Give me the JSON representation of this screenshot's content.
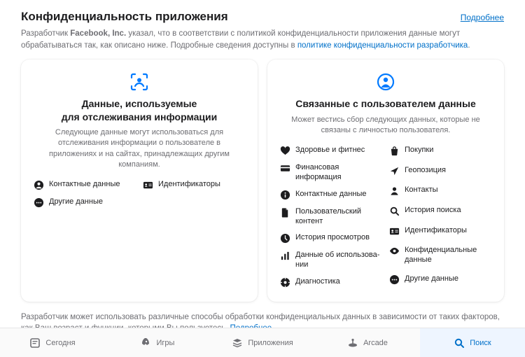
{
  "header": {
    "title": "Конфиденциальность приложения",
    "more": "Подробнее"
  },
  "intro": {
    "prefix": "Разработчик ",
    "developer": "Facebook, Inc.",
    "middle": " указал, что в соответствии с политикой конфиденциальности приложения данные могут обрабатываться так, как описано ниже. Подробные сведения доступны в ",
    "policy_link": "политике конфиденциальности разработчика",
    "suffix": "."
  },
  "cards": {
    "tracking": {
      "title_line1": "Данные, используемые",
      "title_line2": "для отслеживания информации",
      "desc": "Следующие данные могут использоваться для отслеживания информации о пользователе в приложениях и на сайтах, принадлежащих другим компаниям.",
      "items": [
        {
          "icon": "user-circle",
          "label": "Контактные данные"
        },
        {
          "icon": "id-card",
          "label": "Идентификаторы"
        },
        {
          "icon": "ellipsis",
          "label": "Другие данные"
        }
      ]
    },
    "linked": {
      "title": "Связанные с пользователем данные",
      "desc": "Может вестись сбор следующих данных, которые не связаны с личностью пользователя.",
      "left": [
        {
          "icon": "heart",
          "label": "Здоровье и фитнес"
        },
        {
          "icon": "card",
          "label": "Финансовая информация"
        },
        {
          "icon": "info",
          "label": "Контактные данные"
        },
        {
          "icon": "doc",
          "label": "Пользователь­ский контент"
        },
        {
          "icon": "clock",
          "label": "История просмотров"
        },
        {
          "icon": "bars",
          "label": "Данные об использо­ва­нии"
        },
        {
          "icon": "gear",
          "label": "Диагностика"
        }
      ],
      "right": [
        {
          "icon": "bag",
          "label": "Покупки"
        },
        {
          "icon": "plane",
          "label": "Геопозиция"
        },
        {
          "icon": "person",
          "label": "Контакты"
        },
        {
          "icon": "search",
          "label": "История поиска"
        },
        {
          "icon": "id-card",
          "label": "Идентификаторы"
        },
        {
          "icon": "eye",
          "label": "Конфиденциаль­ные данные"
        },
        {
          "icon": "ellipsis",
          "label": "Другие данные"
        }
      ]
    }
  },
  "footnote": {
    "text": "Разработчик может использовать различные способы обработки конфиденциальных данных в зависимости от таких факторов, как Ваш возраст и функции, которыми Вы пользуетесь. ",
    "link": "Подробнее"
  },
  "tabs": [
    {
      "icon": "today",
      "label": "Сегодня"
    },
    {
      "icon": "rocket",
      "label": "Игры"
    },
    {
      "icon": "stack",
      "label": "Приложения"
    },
    {
      "icon": "arcade",
      "label": "Arcade"
    },
    {
      "icon": "search-tab",
      "label": "Поиск",
      "active": true
    }
  ],
  "colors": {
    "accent": "#007aff",
    "text_muted": "#6e6e73"
  }
}
